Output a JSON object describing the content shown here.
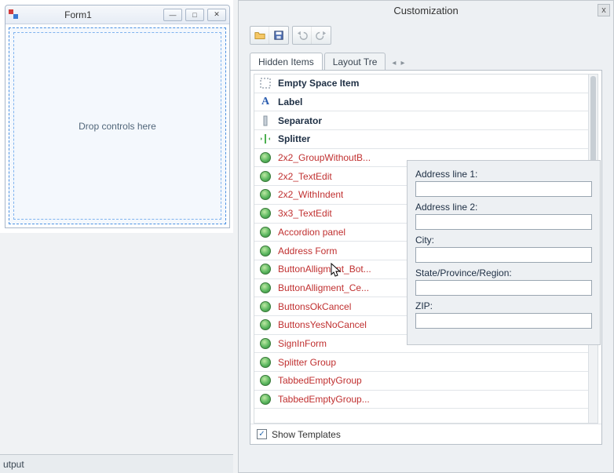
{
  "form": {
    "title": "Form1",
    "drop_hint": "Drop controls here"
  },
  "output_label": "utput",
  "customization": {
    "title": "Customization",
    "close_glyph": "x",
    "toolbar": {
      "open_name": "open-icon",
      "save_name": "save-icon",
      "undo_name": "undo-icon",
      "redo_name": "redo-icon"
    },
    "tabs": {
      "hidden_items": "Hidden Items",
      "layout_tree": "Layout Tre",
      "left_arrow": "◂",
      "right_arrow": "▸"
    },
    "items": [
      {
        "kind": "builtin",
        "label": "Empty Space Item",
        "icon": "empty-space-icon"
      },
      {
        "kind": "builtin",
        "label": "Label",
        "icon": "label-icon"
      },
      {
        "kind": "builtin",
        "label": "Separator",
        "icon": "separator-icon"
      },
      {
        "kind": "builtin",
        "label": "Splitter",
        "icon": "splitter-icon"
      },
      {
        "kind": "template",
        "label": "2x2_GroupWithoutB...",
        "icon": "template-icon"
      },
      {
        "kind": "template",
        "label": "2x2_TextEdit",
        "icon": "template-icon"
      },
      {
        "kind": "template",
        "label": "2x2_WithIndent",
        "icon": "template-icon"
      },
      {
        "kind": "template",
        "label": "3x3_TextEdit",
        "icon": "template-icon"
      },
      {
        "kind": "template",
        "label": "Accordion panel",
        "icon": "template-icon"
      },
      {
        "kind": "template",
        "label": "Address Form",
        "icon": "template-icon"
      },
      {
        "kind": "template",
        "label": "ButtonAlligment_Bot...",
        "icon": "template-icon"
      },
      {
        "kind": "template",
        "label": "ButtonAlligment_Ce...",
        "icon": "template-icon"
      },
      {
        "kind": "template",
        "label": "ButtonsOkCancel",
        "icon": "template-icon"
      },
      {
        "kind": "template",
        "label": "ButtonsYesNoCancel",
        "icon": "template-icon"
      },
      {
        "kind": "template",
        "label": "SignInForm",
        "icon": "template-icon"
      },
      {
        "kind": "template",
        "label": "Splitter Group",
        "icon": "template-icon"
      },
      {
        "kind": "template",
        "label": "TabbedEmptyGroup",
        "icon": "template-icon"
      },
      {
        "kind": "template",
        "label": "TabbedEmptyGroup...",
        "icon": "template-icon"
      }
    ],
    "show_templates_label": "Show Templates"
  },
  "preview": {
    "fields": [
      {
        "label": "Address line 1:"
      },
      {
        "label": "Address line 2:"
      },
      {
        "label": "City:"
      },
      {
        "label": "State/Province/Region:"
      },
      {
        "label": "ZIP:"
      }
    ]
  }
}
